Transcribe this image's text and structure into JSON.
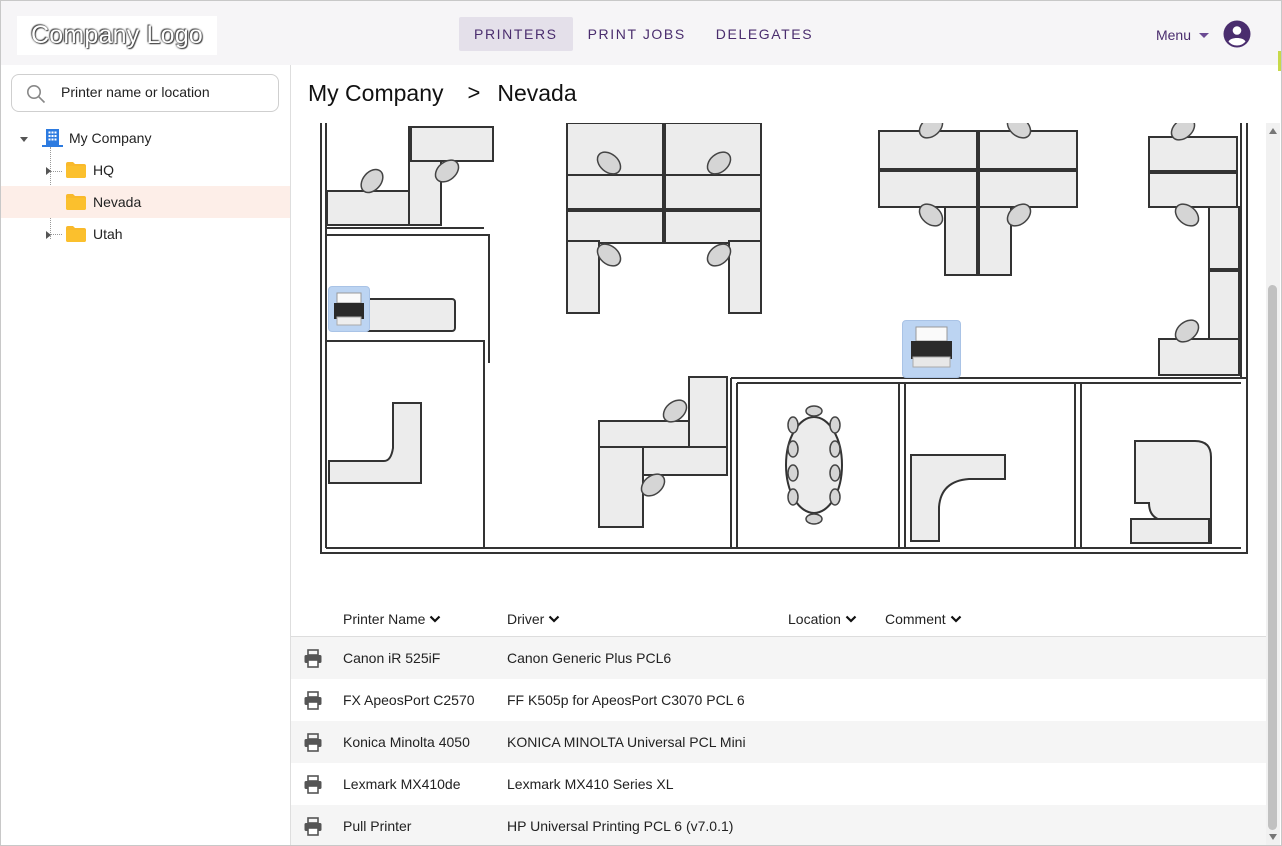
{
  "header": {
    "logo_text": "Company Logo",
    "tabs": [
      {
        "label": "PRINTERS",
        "active": true
      },
      {
        "label": "PRINT JOBS",
        "active": false
      },
      {
        "label": "DELEGATES",
        "active": false
      }
    ],
    "menu_label": "Menu",
    "account_icon": "account-circle-icon"
  },
  "sidebar": {
    "search": {
      "placeholder": "Printer name or location",
      "value": ""
    },
    "tree": [
      {
        "label": "My Company",
        "icon": "building-icon",
        "expanded": true
      },
      {
        "label": "HQ",
        "icon": "folder-icon",
        "expanded": false
      },
      {
        "label": "Nevada",
        "icon": "folder-icon",
        "selected": true
      },
      {
        "label": "Utah",
        "icon": "folder-icon",
        "expanded": false
      }
    ]
  },
  "breadcrumb": {
    "root": "My Company",
    "separator": ">",
    "current": "Nevada"
  },
  "table": {
    "columns": [
      "Printer Name",
      "Driver",
      "Location",
      "Comment"
    ],
    "rows": [
      {
        "name": "Canon iR 525iF",
        "driver": "Canon Generic Plus PCL6",
        "location": "",
        "comment": ""
      },
      {
        "name": "FX ApeosPort C2570",
        "driver": "FF K505p for ApeosPort C3070 PCL 6",
        "location": "",
        "comment": ""
      },
      {
        "name": "Konica Minolta 4050",
        "driver": "KONICA MINOLTA Universal PCL Mini",
        "location": "",
        "comment": ""
      },
      {
        "name": "Lexmark MX410de",
        "driver": "Lexmark MX410 Series XL",
        "location": "",
        "comment": ""
      },
      {
        "name": "Pull Printer",
        "driver": "HP Universal Printing PCL 6 (v7.0.1)",
        "location": "",
        "comment": ""
      }
    ]
  },
  "colors": {
    "accent": "#4a2d6e",
    "header_bg": "#f6f5f7",
    "selected_row": "#fdeee8",
    "folder": "#f9b92b",
    "printer_marker": "#bcd4f2"
  }
}
